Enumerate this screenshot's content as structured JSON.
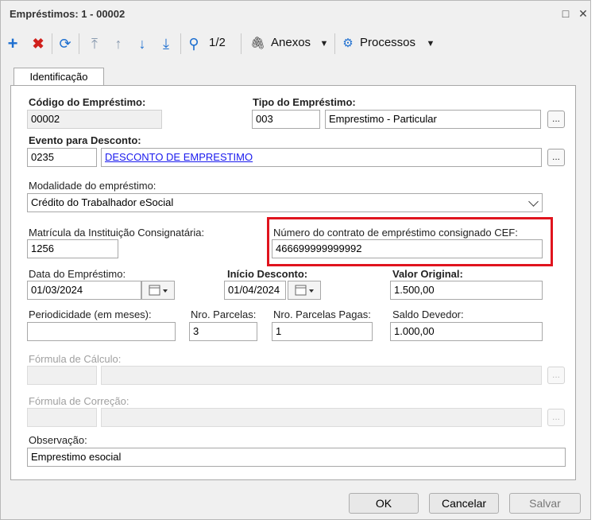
{
  "window": {
    "title": "Empréstimos: 1 - 00002"
  },
  "toolbar": {
    "record_position": "1/2",
    "attachments_label": "Anexos",
    "processes_label": "Processos"
  },
  "tabs": [
    {
      "label": "Identificação"
    }
  ],
  "form": {
    "codigo": {
      "label": "Código do Empréstimo:",
      "value": "00002"
    },
    "tipo": {
      "label": "Tipo do Empréstimo:",
      "code": "003",
      "description": "Emprestimo - Particular"
    },
    "evento": {
      "label": "Evento para Desconto:",
      "code": "0235",
      "description": "DESCONTO DE EMPRESTIMO"
    },
    "modalidade": {
      "label": "Modalidade do empréstimo:",
      "value": "Crédito do Trabalhador eSocial"
    },
    "matricula": {
      "label": "Matrícula da Instituição Consignatária:",
      "value": "1256"
    },
    "contrato": {
      "label": "Número do contrato de empréstimo consignado CEF:",
      "value": "466699999999992"
    },
    "data_emprestimo": {
      "label": "Data do Empréstimo:",
      "value": "01/03/2024"
    },
    "inicio_desconto": {
      "label": "Início Desconto:",
      "value": "01/04/2024"
    },
    "valor_original": {
      "label": "Valor Original:",
      "value": "1.500,00"
    },
    "periodicidade": {
      "label": "Periodicidade (em meses):",
      "value": ""
    },
    "nro_parcelas": {
      "label": "Nro. Parcelas:",
      "value": "3"
    },
    "nro_parcelas_pagas": {
      "label": "Nro. Parcelas Pagas:",
      "value": "1"
    },
    "saldo_devedor": {
      "label": "Saldo Devedor:",
      "value": "1.000,00"
    },
    "formula_calculo": {
      "label": "Fórmula de Cálculo:"
    },
    "formula_correcao": {
      "label": "Fórmula de Correção:"
    },
    "observacao": {
      "label": "Observação:",
      "value": "Emprestimo esocial"
    },
    "lookup_button": "..."
  },
  "footer": {
    "ok_label": "OK",
    "cancel_label": "Cancelar",
    "save_label": "Salvar"
  },
  "colors": {
    "highlight": "#e0141e",
    "link": "#1a1aee"
  }
}
